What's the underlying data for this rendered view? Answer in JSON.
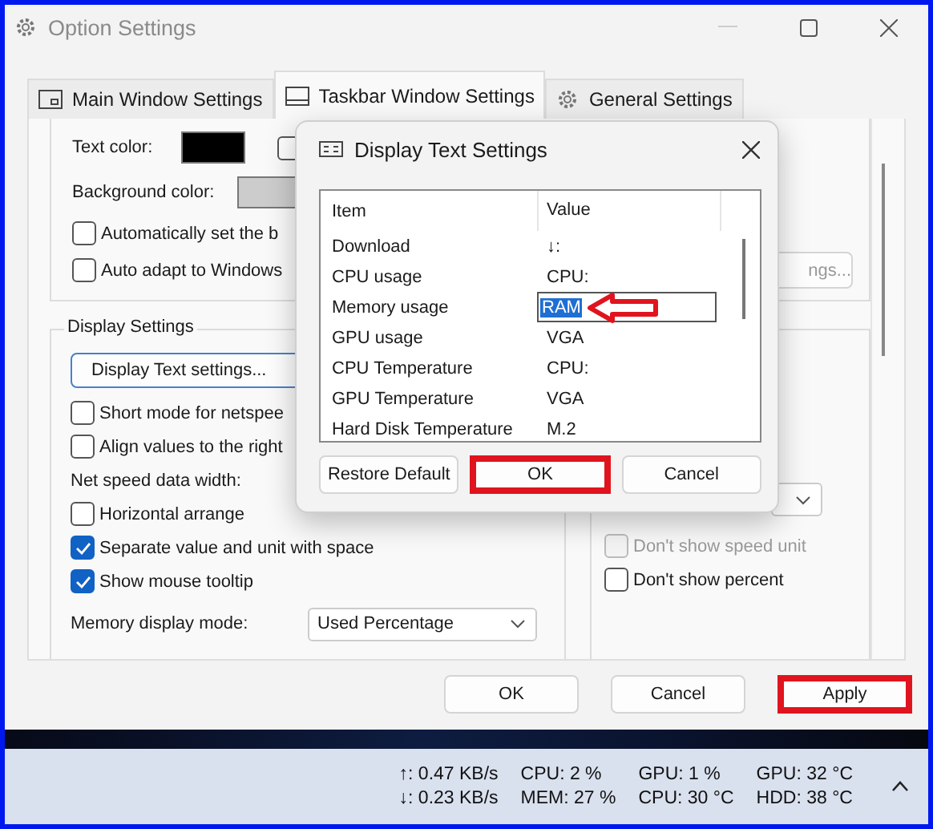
{
  "window": {
    "title": "Option Settings"
  },
  "tabs": [
    {
      "label": "Main Window Settings",
      "selected": false,
      "kind": "window"
    },
    {
      "label": "Taskbar Window Settings",
      "selected": true,
      "kind": "taskbar"
    },
    {
      "label": "General Settings",
      "selected": false,
      "kind": "gear"
    }
  ],
  "color_settings": {
    "text_color_label": "Text color:",
    "text_color_checked": false,
    "background_label": "Background color:",
    "checks": [
      {
        "label": "Automatically set the b",
        "checked": false
      },
      {
        "label": "Auto adapt to Windows",
        "checked": false
      }
    ],
    "button": "ngs..."
  },
  "display_settings": {
    "title": "Display Settings",
    "button": "Display Text settings...",
    "options": [
      {
        "kind": "check",
        "label": "Short mode for netspee",
        "checked": false
      },
      {
        "kind": "check",
        "label": "Align values to the right",
        "checked": false
      },
      {
        "kind": "label",
        "label": "Net speed data width:"
      },
      {
        "kind": "check",
        "label": "Horizontal arrange",
        "checked": false
      },
      {
        "kind": "check",
        "label": "Separate value and unit with space",
        "checked": true
      },
      {
        "kind": "check",
        "label": "Show mouse tooltip",
        "checked": true
      }
    ],
    "memory_mode_label": "Memory display mode:",
    "memory_mode": "Used Percentage"
  },
  "right_options": [
    {
      "label": "Don't show speed unit",
      "checked": false,
      "disabled": true
    },
    {
      "label": "Don't show percent",
      "checked": false,
      "disabled": false
    }
  ],
  "dialog": {
    "title": "Display Text Settings",
    "columns": [
      "Item",
      "Value"
    ],
    "rows": [
      {
        "item": "Download",
        "value": "↓:",
        "selected": false
      },
      {
        "item": "CPU usage",
        "value": "CPU:",
        "selected": false
      },
      {
        "item": "Memory usage",
        "value": "RAM",
        "selected": true
      },
      {
        "item": "GPU usage",
        "value": "VGA",
        "selected": false
      },
      {
        "item": "CPU Temperature",
        "value": "CPU:",
        "selected": false
      },
      {
        "item": "GPU Temperature",
        "value": "VGA",
        "selected": false
      },
      {
        "item": "Hard Disk Temperature",
        "value": "M.2",
        "selected": false
      }
    ],
    "buttons": [
      {
        "label": "Restore Default",
        "highlighted": false
      },
      {
        "label": "OK",
        "highlighted": true
      },
      {
        "label": "Cancel",
        "highlighted": false
      }
    ]
  },
  "buttons": [
    {
      "label": "OK",
      "highlighted": false
    },
    {
      "label": "Cancel",
      "highlighted": false
    },
    {
      "label": "Apply",
      "highlighted": true
    }
  ],
  "taskbar": {
    "columns": [
      {
        "top": "↑: 0.47 KB/s",
        "bottom": "↓: 0.23 KB/s"
      },
      {
        "top": "CPU: 2 %",
        "bottom": "MEM: 27 %"
      },
      {
        "top": "GPU: 1 %",
        "bottom": "CPU: 30 °C"
      },
      {
        "top": "GPU: 32 °C",
        "bottom": "HDD: 38 °C"
      }
    ]
  }
}
